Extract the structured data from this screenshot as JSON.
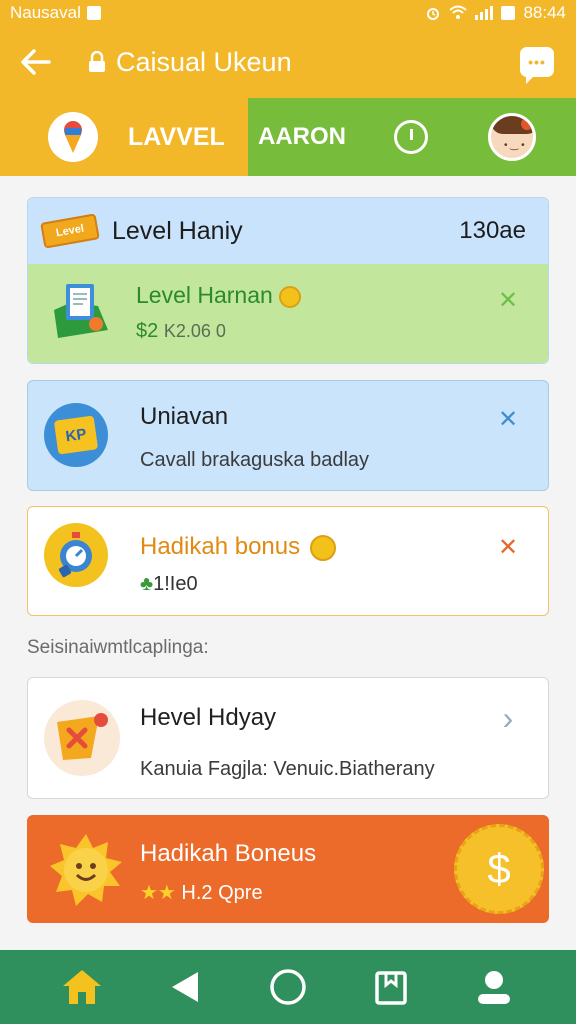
{
  "status_bar": {
    "carrier": "Nausaval",
    "time": "88:44"
  },
  "header": {
    "title": "Caisual Ukeun"
  },
  "tabs": {
    "left_label": "LAVVEL",
    "right_label": "AARON"
  },
  "cards": [
    {
      "title": "Level Haniy",
      "count": "130ae",
      "ticket_text": "Level",
      "sub_title": "Level Harnan",
      "amount_prefix": "$2",
      "amount_rest": "K2.06 0",
      "close": "✕"
    },
    {
      "title": "Uniavan",
      "subtitle": "Cavall brakaguska badlay",
      "badge": "KP",
      "close": "✕"
    },
    {
      "title": "Hadikah bonus",
      "subtitle": "1!Ie0",
      "close": "✕"
    }
  ],
  "section_label": "Seisinaiwmtlcaplinga:",
  "cards_more": [
    {
      "title": "Hevel Hdyay",
      "subtitle": "Kanuia Fagjla: Venuic.Biatherany",
      "chevron": "›"
    },
    {
      "title": "Hadikah Boneus",
      "subtitle": "H.2 Qpre",
      "coin_symbol": "$"
    }
  ],
  "colors": {
    "header": "#f3b72a",
    "tab_green": "#78bc3b",
    "nav": "#2f8f5d",
    "orange_card": "#ec6b2a",
    "green_text": "#2b8a2b",
    "blue_x": "#3e8fd0",
    "orange_x": "#e36a2b"
  },
  "icons": [
    "back-arrow-icon",
    "lock-icon",
    "chat-icon",
    "ice-cream-icon",
    "clock-icon",
    "avatar",
    "ticket-icon",
    "document-icon",
    "tag-icon",
    "stopwatch-icon",
    "flag-icon",
    "sun-icon",
    "coin-icon",
    "home-icon",
    "back-triangle-icon",
    "circle-home-icon",
    "recents-icon",
    "profile-icon"
  ]
}
